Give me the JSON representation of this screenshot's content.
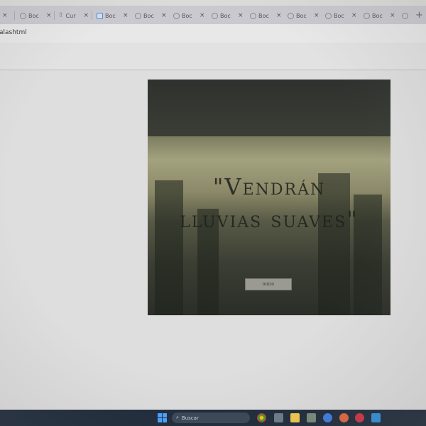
{
  "browser": {
    "tabs": [
      {
        "label": "",
        "icon": "globe-icon"
      },
      {
        "label": "Boc",
        "icon": "globe-icon"
      },
      {
        "label": "Cur",
        "icon": "upload-icon"
      },
      {
        "label": "Boc",
        "icon": "page-icon"
      },
      {
        "label": "Boc",
        "icon": "globe-icon"
      },
      {
        "label": "Boc",
        "icon": "globe-icon"
      },
      {
        "label": "Boc",
        "icon": "globe-icon"
      },
      {
        "label": "Boc",
        "icon": "globe-icon"
      },
      {
        "label": "Boc",
        "icon": "globe-icon"
      },
      {
        "label": "Boc",
        "icon": "globe-icon"
      },
      {
        "label": "Boc",
        "icon": "globe-icon"
      },
      {
        "label": "Boc",
        "icon": "globe-icon"
      }
    ],
    "close_glyph": "×",
    "new_tab_glyph": "+",
    "url": "alashtml"
  },
  "hero": {
    "title_line1": "\"Vendrán",
    "title_line2": "lluvias suaves\"",
    "button_label": "Inicio"
  },
  "taskbar": {
    "search_placeholder": "Buscar"
  },
  "colors": {
    "taskbar": "#1e2a3a",
    "hero_dark": "#2c2f2b",
    "hero_mist": "#a3a27e"
  }
}
